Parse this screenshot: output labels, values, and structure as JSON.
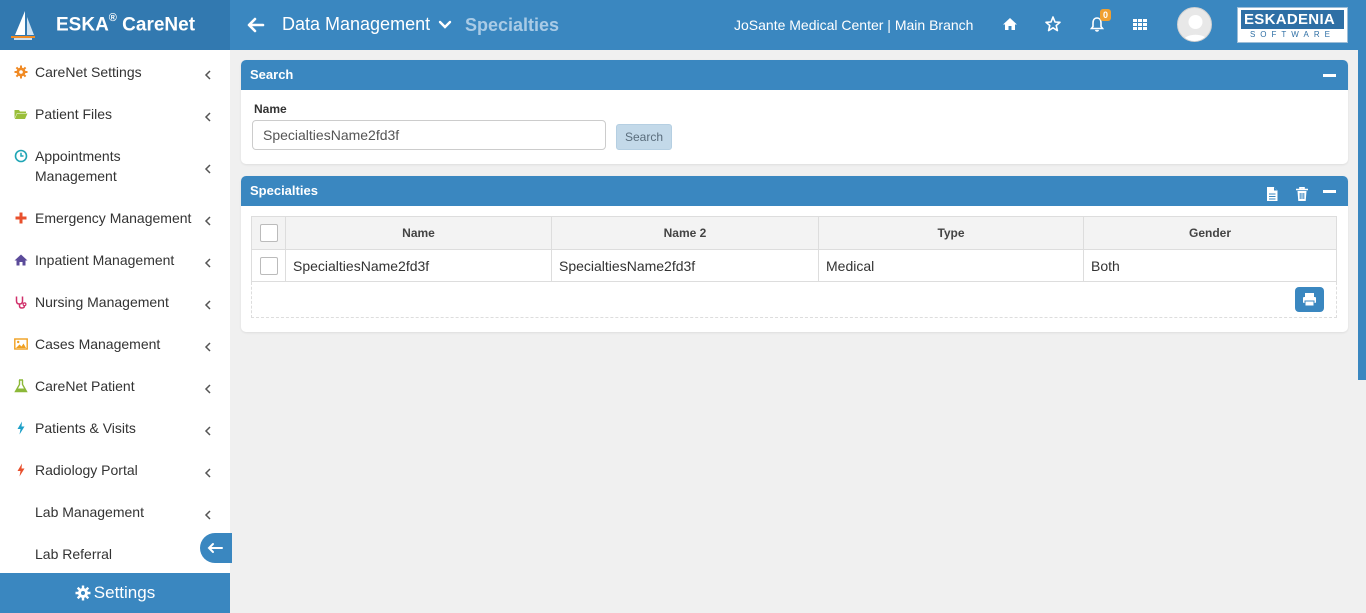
{
  "app": {
    "title": "ESKA",
    "title_reg": "®",
    "title_suffix": " CareNet"
  },
  "header": {
    "breadcrumb_main": "Data Management",
    "breadcrumb_sub": "Specialties",
    "center_name": "JoSante Medical Center | Main Branch",
    "notification_count": "0",
    "vendor_logo_top": "ESKADENIA",
    "vendor_logo_bottom": "SOFTWARE"
  },
  "sidebar": {
    "items": [
      {
        "label": "CareNet Settings",
        "icon": "gear-icon",
        "color": "#f08a24"
      },
      {
        "label": "Patient Files",
        "icon": "folder-open-icon",
        "color": "#9abf3a"
      },
      {
        "label": "Appointments Management",
        "icon": "clock-icon",
        "color": "#1fa5b5"
      },
      {
        "label": "Emergency Management",
        "icon": "plus-icon",
        "color": "#e8502d"
      },
      {
        "label": "Inpatient Management",
        "icon": "home-icon",
        "color": "#5b4b9a"
      },
      {
        "label": "Nursing Management",
        "icon": "stethoscope-icon",
        "color": "#d0306a"
      },
      {
        "label": "Cases Management",
        "icon": "image-icon",
        "color": "#f0a020"
      },
      {
        "label": "CareNet Patient",
        "icon": "flask-icon",
        "color": "#8cb838"
      },
      {
        "label": "Patients & Visits",
        "icon": "bolt-icon",
        "color": "#1ea0c8"
      },
      {
        "label": "Radiology Portal",
        "icon": "bolt-icon",
        "color": "#e8502d"
      },
      {
        "label": "Lab Management",
        "icon": "",
        "color": ""
      },
      {
        "label": "Lab Referral",
        "icon": "",
        "color": ""
      }
    ],
    "settings_label": "Settings"
  },
  "search_panel": {
    "title": "Search",
    "name_label": "Name",
    "name_value": "SpecialtiesName2fd3f",
    "search_button": "Search"
  },
  "results_panel": {
    "title": "Specialties",
    "columns": [
      "Name",
      "Name 2",
      "Type",
      "Gender"
    ],
    "rows": [
      {
        "name": "SpecialtiesName2fd3f",
        "name2": "SpecialtiesName2fd3f",
        "type": "Medical",
        "gender": "Both"
      }
    ]
  },
  "colors": {
    "primary": "#3a87c0",
    "brand_dark": "#3279b0",
    "badge": "#f0a030"
  }
}
